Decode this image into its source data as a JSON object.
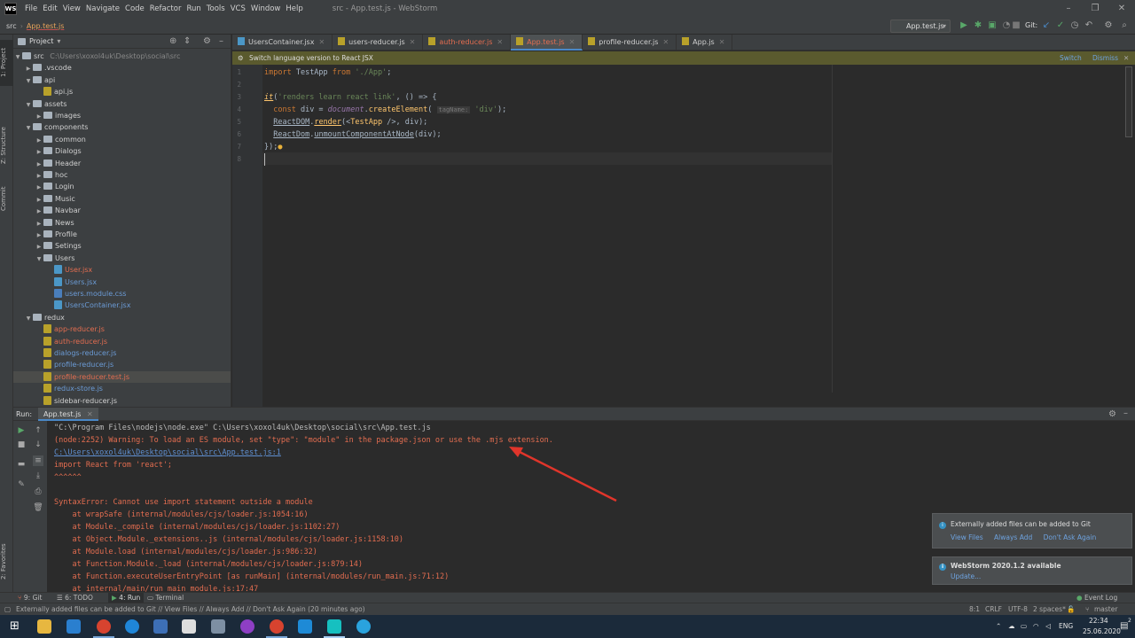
{
  "window": {
    "title": "src - App.test.js - WebStorm",
    "menu": [
      "File",
      "Edit",
      "View",
      "Navigate",
      "Code",
      "Refactor",
      "Run",
      "Tools",
      "VCS",
      "Window",
      "Help"
    ]
  },
  "navbar": {
    "crumbs": [
      "src",
      "App.test.js"
    ],
    "run_config": "App.test.js",
    "git_label": "Git:"
  },
  "project": {
    "header": "Project",
    "root": "src",
    "root_path": "C:\\Users\\xoxol4uk\\Desktop\\social\\src",
    "tree": [
      {
        "label": ".vscode",
        "type": "folder",
        "depth": 1,
        "open": false
      },
      {
        "label": "api",
        "type": "folder",
        "depth": 1,
        "open": true
      },
      {
        "label": "api.js",
        "type": "js",
        "depth": 2
      },
      {
        "label": "assets",
        "type": "folder",
        "depth": 1,
        "open": true
      },
      {
        "label": "images",
        "type": "folder",
        "depth": 2,
        "open": false
      },
      {
        "label": "components",
        "type": "folder",
        "depth": 1,
        "open": true
      },
      {
        "label": "common",
        "type": "folder",
        "depth": 2,
        "open": false
      },
      {
        "label": "Dialogs",
        "type": "folder",
        "depth": 2,
        "open": false
      },
      {
        "label": "Header",
        "type": "folder",
        "depth": 2,
        "open": false
      },
      {
        "label": "hoc",
        "type": "folder",
        "depth": 2,
        "open": false
      },
      {
        "label": "Login",
        "type": "folder",
        "depth": 2,
        "open": false
      },
      {
        "label": "Music",
        "type": "folder",
        "depth": 2,
        "open": false
      },
      {
        "label": "Navbar",
        "type": "folder",
        "depth": 2,
        "open": false
      },
      {
        "label": "News",
        "type": "folder",
        "depth": 2,
        "open": false
      },
      {
        "label": "Profile",
        "type": "folder",
        "depth": 2,
        "open": false
      },
      {
        "label": "Setings",
        "type": "folder",
        "depth": 2,
        "open": false
      },
      {
        "label": "Users",
        "type": "folder",
        "depth": 2,
        "open": true
      },
      {
        "label": "User.jsx",
        "type": "jsx",
        "depth": 3,
        "color": "red"
      },
      {
        "label": "Users.jsx",
        "type": "jsx",
        "depth": 3,
        "color": "blue"
      },
      {
        "label": "users.module.css",
        "type": "css",
        "depth": 3,
        "color": "blue"
      },
      {
        "label": "UsersContainer.jsx",
        "type": "jsx",
        "depth": 3,
        "color": "blue"
      },
      {
        "label": "redux",
        "type": "folder",
        "depth": 1,
        "open": true
      },
      {
        "label": "app-reducer.js",
        "type": "js",
        "depth": 2,
        "color": "red"
      },
      {
        "label": "auth-reducer.js",
        "type": "js",
        "depth": 2,
        "color": "red"
      },
      {
        "label": "dialogs-reducer.js",
        "type": "js",
        "depth": 2,
        "color": "blue"
      },
      {
        "label": "profile-reducer.js",
        "type": "js",
        "depth": 2,
        "color": "blue"
      },
      {
        "label": "profile-reducer.test.js",
        "type": "js",
        "depth": 2,
        "color": "red",
        "selected": true
      },
      {
        "label": "redux-store.js",
        "type": "js",
        "depth": 2,
        "color": "blue"
      },
      {
        "label": "sidebar-reducer.js",
        "type": "js",
        "depth": 2
      }
    ]
  },
  "tabs": [
    {
      "label": "UsersContainer.jsx",
      "kind": "jsx",
      "color": "normal"
    },
    {
      "label": "users-reducer.js",
      "kind": "js",
      "color": "normal"
    },
    {
      "label": "auth-reducer.js",
      "kind": "js",
      "color": "err"
    },
    {
      "label": "App.test.js",
      "kind": "js",
      "color": "err",
      "active": true
    },
    {
      "label": "profile-reducer.js",
      "kind": "js",
      "color": "normal"
    },
    {
      "label": "App.js",
      "kind": "js",
      "color": "normal"
    }
  ],
  "banner": {
    "text": "Switch language version to React JSX",
    "switch": "Switch",
    "dismiss": "Dismiss"
  },
  "editor": {
    "line_numbers": [
      "1",
      "2",
      "3",
      "4",
      "5",
      "6",
      "7",
      "8"
    ]
  },
  "run": {
    "label": "Run:",
    "tab": "App.test.js",
    "lines": [
      "\"C:\\Program Files\\nodejs\\node.exe\" C:\\Users\\xoxol4uk\\Desktop\\social\\src\\App.test.js",
      "(node:2252) Warning: To load an ES module, set \"type\": \"module\" in the package.json or use the .mjs extension.",
      "C:\\Users\\xoxol4uk\\Desktop\\social\\src\\App.test.js:1",
      "import React from 'react';",
      "^^^^^^",
      "",
      "SyntaxError: Cannot use import statement outside a module",
      "    at wrapSafe (internal/modules/cjs/loader.js:1054:16)",
      "    at Module._compile (internal/modules/cjs/loader.js:1102:27)",
      "    at Object.Module._extensions..js (internal/modules/cjs/loader.js:1158:10)",
      "    at Module.load (internal/modules/cjs/loader.js:986:32)",
      "    at Function.Module._load (internal/modules/cjs/loader.js:879:14)",
      "    at Function.executeUserEntryPoint [as runMain] (internal/modules/run_main.js:71:12)",
      "    at internal/main/run_main_module.js:17:47"
    ]
  },
  "notifications": [
    {
      "text": "Externally added files can be added to Git",
      "links": [
        "View Files",
        "Always Add",
        "Don't Ask Again"
      ]
    },
    {
      "text": "WebStorm 2020.1.2 available",
      "links": [
        "Update..."
      ]
    }
  ],
  "bottom_tabs": {
    "git": "9: Git",
    "todo": "6: TODO",
    "run": "4: Run",
    "terminal": "Terminal",
    "event_log": "Event Log"
  },
  "left_tabs": {
    "project": "1: Project",
    "structure": "Z: Structure",
    "commit": "Commit",
    "favorites": "2: Favorites"
  },
  "status": {
    "message": "Externally added files can be added to Git // View Files // Always Add // Don't Ask Again (20 minutes ago)",
    "position": "8:1",
    "line_sep": "CRLF",
    "encoding": "UTF-8",
    "indent": "2 spaces*",
    "branch": "master"
  },
  "taskbar": {
    "lang": "ENG",
    "time": "22:34",
    "date": "25.06.2020",
    "notif_count": "2"
  }
}
